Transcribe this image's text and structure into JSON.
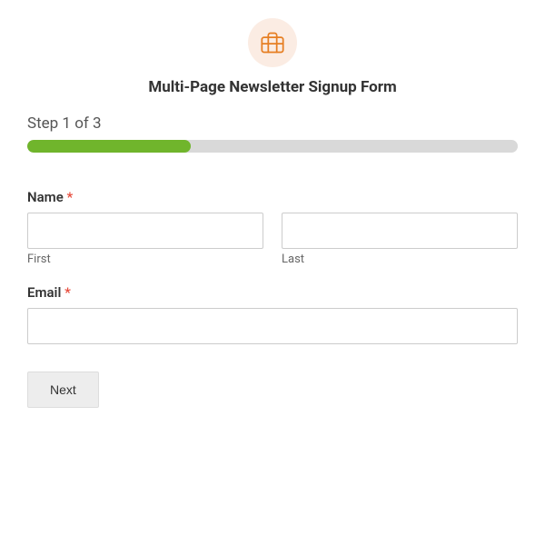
{
  "header": {
    "title": "Multi-Page Newsletter Signup Form"
  },
  "progress": {
    "label": "Step 1 of 3"
  },
  "fields": {
    "name": {
      "label": "Name",
      "required": "*",
      "first_sublabel": "First",
      "last_sublabel": "Last"
    },
    "email": {
      "label": "Email",
      "required": "*"
    }
  },
  "buttons": {
    "next": "Next"
  }
}
